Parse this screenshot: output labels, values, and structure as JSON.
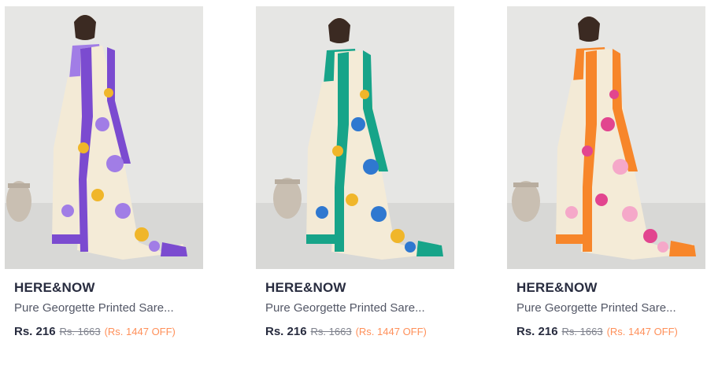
{
  "products": [
    {
      "brand": "HERE&NOW",
      "title": "Pure Georgette Printed Sare...",
      "price": "Rs. 216",
      "mrp": "Rs. 1663",
      "discount": "(Rs. 1447 OFF)",
      "colors": {
        "border": "#7b4bd0",
        "accent": "#a17de6",
        "bloom": "#f0b62a"
      }
    },
    {
      "brand": "HERE&NOW",
      "title": "Pure Georgette Printed Sare...",
      "price": "Rs. 216",
      "mrp": "Rs. 1663",
      "discount": "(Rs. 1447 OFF)",
      "colors": {
        "border": "#17a489",
        "accent": "#2f78d0",
        "bloom": "#f0b62a"
      }
    },
    {
      "brand": "HERE&NOW",
      "title": "Pure Georgette Printed Sare...",
      "price": "Rs. 216",
      "mrp": "Rs. 1663",
      "discount": "(Rs. 1447 OFF)",
      "colors": {
        "border": "#f7862a",
        "accent": "#e2458f",
        "bloom": "#f5a8c9"
      }
    }
  ]
}
